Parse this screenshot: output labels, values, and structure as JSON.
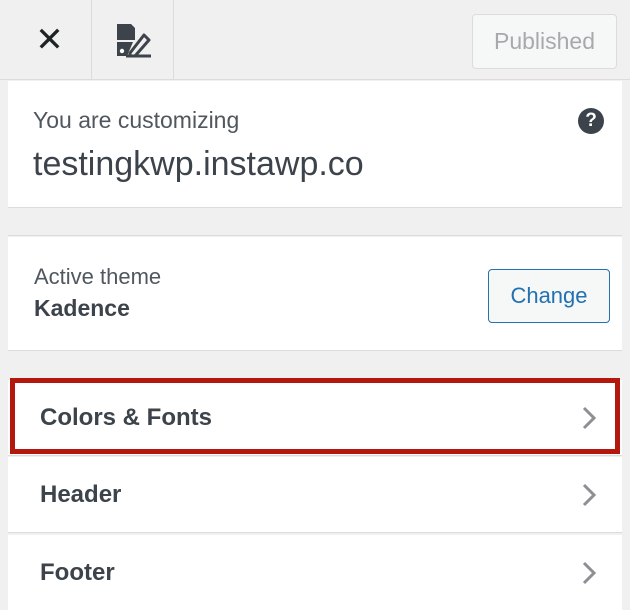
{
  "topbar": {
    "close_icon": "close-icon",
    "style_icon": "brush-icon",
    "published_label": "Published"
  },
  "info": {
    "prefix": "You are customizing",
    "site": "testingkwp.instawp.co",
    "help_icon": "help-icon"
  },
  "theme": {
    "label": "Active theme",
    "name": "Kadence",
    "change_label": "Change"
  },
  "sections": [
    {
      "label": "Colors & Fonts",
      "highlighted": true
    },
    {
      "label": "Header"
    },
    {
      "label": "Footer"
    }
  ],
  "colors": {
    "highlight": "#b3170e",
    "accent": "#2271b1"
  }
}
